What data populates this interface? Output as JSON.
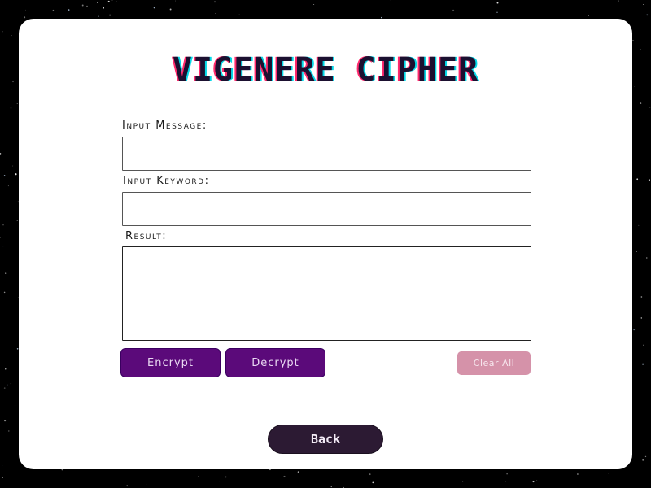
{
  "page": {
    "title": "VIGENERE CIPHER"
  },
  "form": {
    "message_label": "Input Message:",
    "message_value": "",
    "keyword_label": "Input Keyword:",
    "keyword_value": "",
    "result_label": "Result:",
    "result_value": ""
  },
  "actions": {
    "encrypt_label": "Encrypt",
    "decrypt_label": "Decrypt",
    "clear_label": "Clear All",
    "back_label": "Back"
  },
  "colors": {
    "background": "#000000",
    "card": "#ffffff",
    "primary_button": "#5b0a7a",
    "clear_button": "#d592a9",
    "back_button": "#2c1a33",
    "title_glitch_red": "#ff2a6d",
    "title_glitch_cyan": "#05d9e8"
  },
  "icons": {
    "background": "starfield"
  }
}
